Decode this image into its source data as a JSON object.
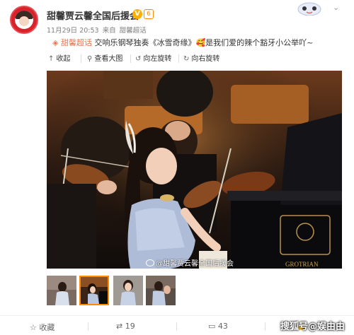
{
  "post": {
    "author": "甜馨贾云馨全国后援会",
    "verified": "V",
    "level": "6",
    "date": "11月29日 20:53",
    "from_label": "来自",
    "source": "甜馨超话",
    "topic": "甜馨超话",
    "text_main": " 交响乐钢琴独奏《冰雪奇缘》",
    "text_tail": "是我们爱的辣个豁牙小公举吖~"
  },
  "toolbar": {
    "collapse": "收起",
    "view_large": "查看大图",
    "rotate_left": "向左旋转",
    "rotate_right": "向右旋转"
  },
  "image": {
    "watermark": "@甜馨贾云馨全国后援会",
    "piano_brand": "GROTRIAN"
  },
  "footer": {
    "favorite": "收藏",
    "repost": "19",
    "comment": "43",
    "like": "",
    "brand": "搜狐号@娱由由"
  },
  "colors": {
    "accent": "#eb7350",
    "verified": "#ffae00"
  }
}
